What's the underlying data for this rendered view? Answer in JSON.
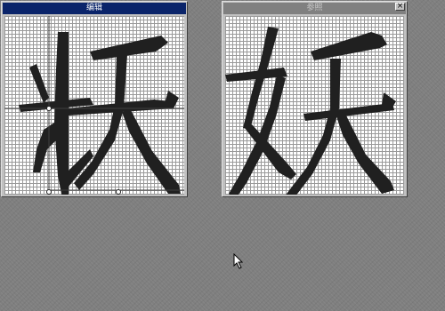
{
  "windows": {
    "edit": {
      "title": "编辑"
    },
    "reference": {
      "title": "参照",
      "close_label": "×"
    }
  },
  "glyphs": {
    "edit": "妖",
    "reference": "妖"
  },
  "colors": {
    "desktop": "#7f7f7f",
    "active_titlebar": "#0a246a",
    "inactive_titlebar": "#808080",
    "grid_line": "#9a9a9a",
    "ink": "#202020"
  },
  "icons": {
    "pointer": "arrow-cursor-icon",
    "close": "close-icon"
  }
}
